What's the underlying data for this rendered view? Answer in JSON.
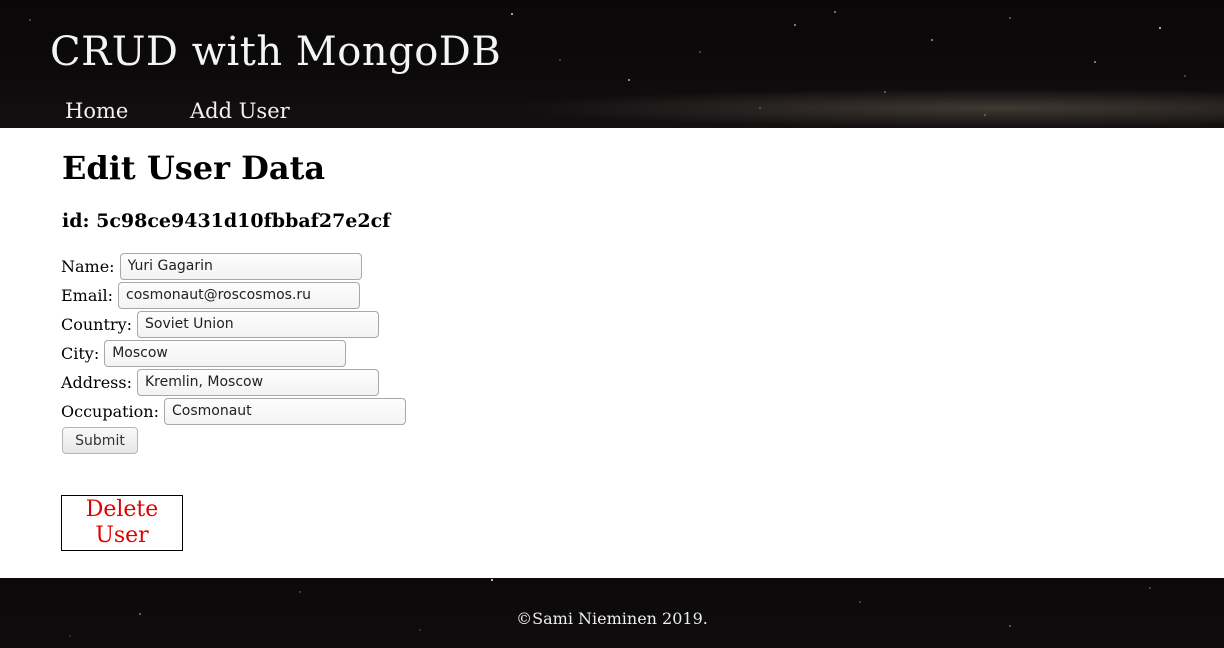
{
  "header": {
    "site_title": "CRUD with MongoDB",
    "nav": {
      "home": "Home",
      "add_user": "Add User"
    }
  },
  "main": {
    "page_title": "Edit User Data",
    "record_id": "id: 5c98ce9431d10fbbaf27e2cf",
    "form": {
      "name": {
        "label": "Name:",
        "value": "Yuri Gagarin"
      },
      "email": {
        "label": "Email:",
        "value": "cosmonaut@roscosmos.ru"
      },
      "country": {
        "label": "Country:",
        "value": "Soviet Union"
      },
      "city": {
        "label": "City:",
        "value": "Moscow"
      },
      "address": {
        "label": "Address:",
        "value": "Kremlin, Moscow"
      },
      "occupation": {
        "label": "Occupation:",
        "value": "Cosmonaut"
      },
      "submit_label": "Submit"
    },
    "delete_label": "Delete User",
    "colors": {
      "delete_text": "#e00000"
    }
  },
  "footer": {
    "copyright": "©Sami Nieminen 2019."
  }
}
